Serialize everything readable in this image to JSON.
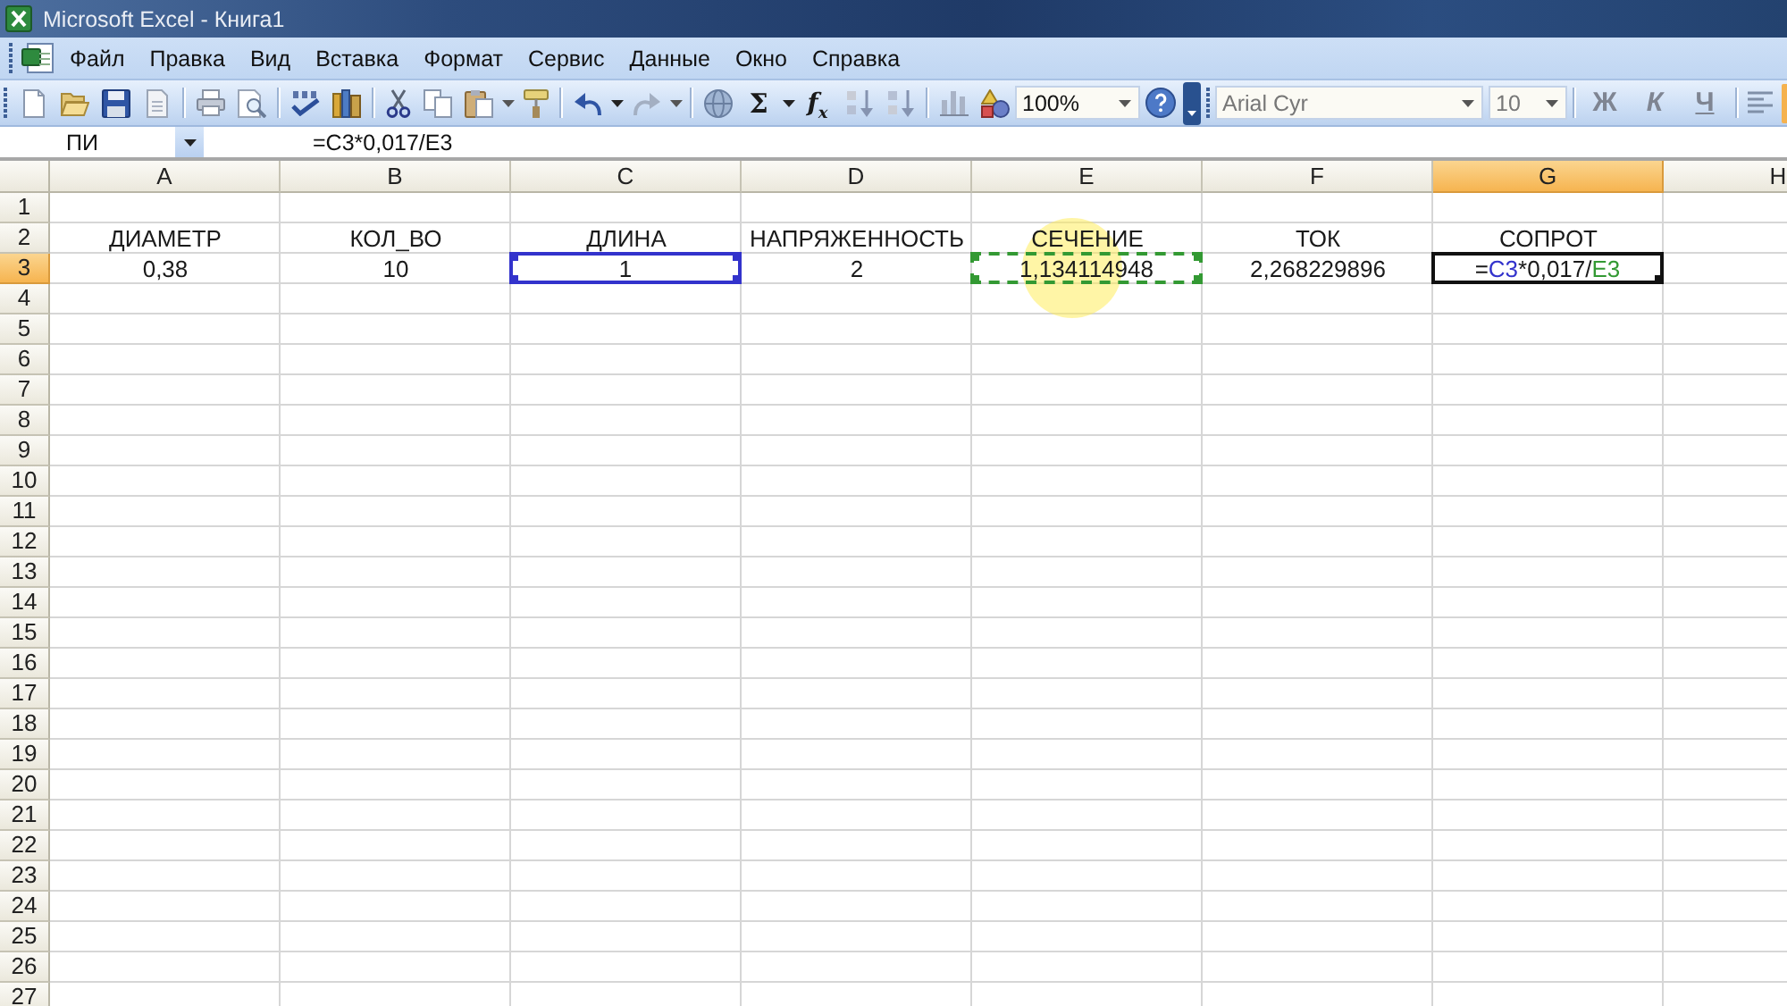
{
  "window": {
    "title": "Microsoft Excel - Книга1"
  },
  "menu": [
    {
      "label": "Файл"
    },
    {
      "label": "Правка"
    },
    {
      "label": "Вид"
    },
    {
      "label": "Вставка"
    },
    {
      "label": "Формат"
    },
    {
      "label": "Сервис"
    },
    {
      "label": "Данные"
    },
    {
      "label": "Окно"
    },
    {
      "label": "Справка"
    }
  ],
  "standard_toolbar": {
    "autosum": "Σ",
    "function": "f$_{x}$",
    "zoom": "100%"
  },
  "formatting_toolbar": {
    "disabled": true,
    "font": "Arial Cyr",
    "size": "10",
    "bold": "Ж",
    "italic": "К",
    "underline": "Ч"
  },
  "formula_bar": {
    "name_box": "ПИ",
    "formula": "=C3*0,017/E3"
  },
  "sheet": {
    "columns": [
      {
        "label": "A",
        "selected": false
      },
      {
        "label": "B",
        "selected": false
      },
      {
        "label": "C",
        "selected": false
      },
      {
        "label": "D",
        "selected": false
      },
      {
        "label": "E",
        "selected": false
      },
      {
        "label": "F",
        "selected": false
      },
      {
        "label": "G",
        "selected": true
      },
      {
        "label": "H",
        "selected": false
      }
    ],
    "rows": [
      {
        "label": "1",
        "selected": false
      },
      {
        "label": "2",
        "selected": false,
        "cells": [
          {
            "value": "ДИАМЕТР"
          },
          {
            "value": "КОЛ_ВО"
          },
          {
            "value": "ДЛИНА"
          },
          {
            "value": "НАПРЯЖЕННОСТЬ"
          },
          {
            "value": "СЕЧЕНИЕ"
          },
          {
            "value": "ТОК"
          },
          {
            "value": "СОПРОТ"
          }
        ]
      },
      {
        "label": "3",
        "selected": true,
        "cells": [
          {
            "kind": "value",
            "value": "0,38"
          },
          {
            "kind": "value",
            "value": "10"
          },
          {
            "kind": "reference",
            "value": "1",
            "color": "#3333cc"
          },
          {
            "kind": "value",
            "value": "2"
          },
          {
            "kind": "marquee",
            "value": "1,134114948",
            "color": "#339933"
          },
          {
            "kind": "value",
            "value": "2,268229896"
          },
          {
            "kind": "formula",
            "active": true,
            "parts": [
              {
                "text": "="
              },
              {
                "text": "C3",
                "color": "#3333cc"
              },
              {
                "text": "*0,017/"
              },
              {
                "text": "E3",
                "color": "#339933"
              }
            ]
          }
        ]
      },
      {
        "label": "4",
        "selected": false
      },
      {
        "label": "5",
        "selected": false
      },
      {
        "label": "6",
        "selected": false
      },
      {
        "label": "7",
        "selected": false
      },
      {
        "label": "8",
        "selected": false
      },
      {
        "label": "9",
        "selected": false
      },
      {
        "label": "10",
        "selected": false
      },
      {
        "label": "11",
        "selected": false
      },
      {
        "label": "12",
        "selected": false
      },
      {
        "label": "13",
        "selected": false
      },
      {
        "label": "14",
        "selected": false
      },
      {
        "label": "15",
        "selected": false
      },
      {
        "label": "16",
        "selected": false
      },
      {
        "label": "17",
        "selected": false
      },
      {
        "label": "18",
        "selected": false
      },
      {
        "label": "19",
        "selected": false
      },
      {
        "label": "20",
        "selected": false
      },
      {
        "label": "21",
        "selected": false
      },
      {
        "label": "22",
        "selected": false
      },
      {
        "label": "23",
        "selected": false
      },
      {
        "label": "24",
        "selected": false
      },
      {
        "label": "25",
        "selected": false
      },
      {
        "label": "26",
        "selected": false
      },
      {
        "label": "27",
        "selected": false
      }
    ]
  }
}
